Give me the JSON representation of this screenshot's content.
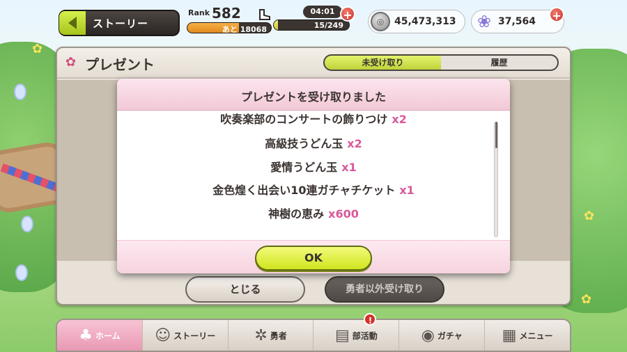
{
  "top_bar": {
    "story_label": "ストーリー",
    "rank_label": "Rank",
    "rank_value": "582",
    "rank_next": "あと 18068",
    "rank_progress": 0.62,
    "stamina_timer": "04:01",
    "stamina_count": "15/249",
    "stamina_progress": 0.06,
    "coin_value": "45,473,313",
    "gem_value": "37,564"
  },
  "panel": {
    "title": "プレゼント",
    "tabs": [
      {
        "label": "未受け取り",
        "active": true
      },
      {
        "label": "履歴",
        "active": false
      }
    ],
    "close_label": "とじる",
    "bulk_label": "勇者以外受け取り"
  },
  "modal": {
    "title": "プレゼントを受け取りました",
    "items": [
      {
        "name": "吹奏楽部のコンサートの飾りつけ",
        "qty": "x2"
      },
      {
        "name": "高級技うどん玉",
        "qty": "x2"
      },
      {
        "name": "愛情うどん玉",
        "qty": "x1"
      },
      {
        "name": "金色煌く出会い10連ガチャチケット",
        "qty": "x1"
      },
      {
        "name": "神樹の恵み",
        "qty": "x600"
      }
    ],
    "ok_label": "OK"
  },
  "nav": {
    "items": [
      {
        "label": "ホーム",
        "icon": "home-icon"
      },
      {
        "label": "ストーリー",
        "icon": "story-icon"
      },
      {
        "label": "勇者",
        "icon": "hero-icon"
      },
      {
        "label": "部活動",
        "icon": "club-icon",
        "badge": "!"
      },
      {
        "label": "ガチャ",
        "icon": "gacha-icon"
      },
      {
        "label": "メニュー",
        "icon": "menu-icon"
      }
    ]
  },
  "colors": {
    "accent_green": "#cfe51f",
    "accent_pink": "#d9599a",
    "modal_header": "#f2c9d6"
  }
}
